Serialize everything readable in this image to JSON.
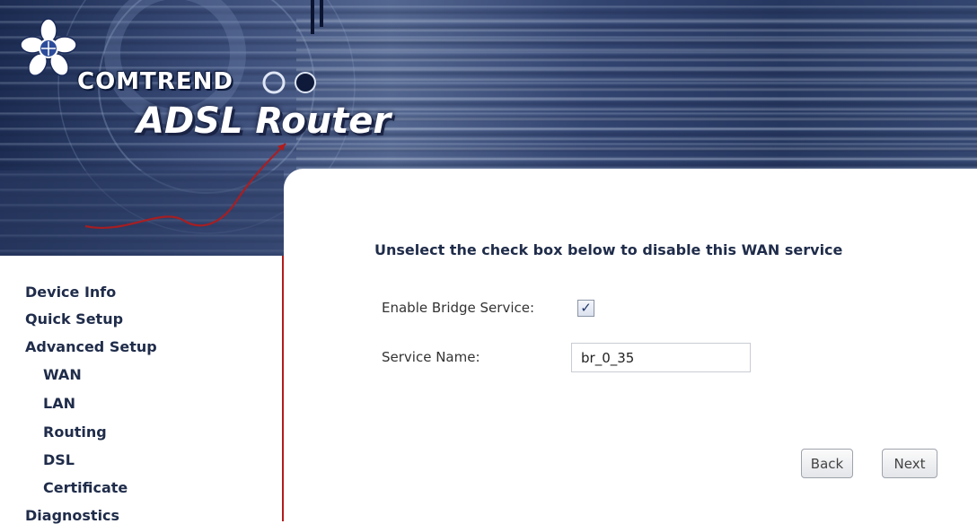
{
  "brand": {
    "logo_text": "COMTREND",
    "product_title": "ADSL Router",
    "accent_color": "#b31b1b",
    "banner_color": "#2a3a63"
  },
  "nav": {
    "items": [
      {
        "label": "Device Info"
      },
      {
        "label": "Quick Setup"
      },
      {
        "label": "Advanced Setup"
      },
      {
        "label": "WAN"
      },
      {
        "label": "LAN"
      },
      {
        "label": "Routing"
      },
      {
        "label": "DSL"
      },
      {
        "label": "Certificate"
      },
      {
        "label": "Diagnostics"
      }
    ]
  },
  "content": {
    "heading": "Unselect the check box below to disable this WAN service",
    "enable_label": "Enable Bridge Service:",
    "enable_checked": true,
    "service_name_label": "Service Name:",
    "service_name_value": "br_0_35"
  },
  "buttons": {
    "back_label": "Back",
    "next_label": "Next"
  },
  "icons": {
    "logo": "comtrend-flower-logo-icon",
    "checkmark": "checkmark-icon"
  }
}
